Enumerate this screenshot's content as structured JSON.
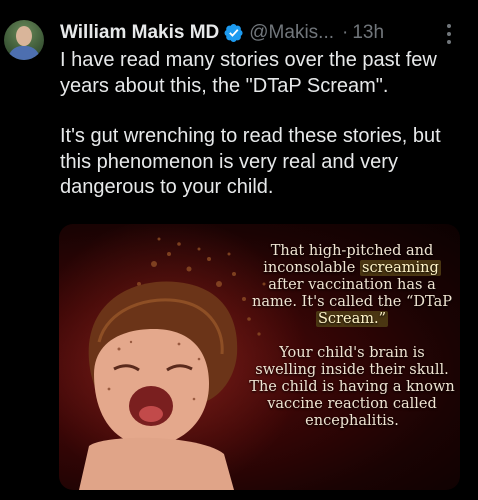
{
  "author": {
    "name": "William Makis MD",
    "handle": "@Makis...",
    "separator": "·",
    "time": "13h",
    "verified_color": "#1d9bf0"
  },
  "icons": {
    "verified": "verified-badge-icon",
    "more": "more-options-icon",
    "avatar": "profile-avatar"
  },
  "tweet": {
    "paragraph1": "I have read many stories over the past few years about this, the \"DTaP Scream\".",
    "paragraph2": "It's gut wrenching to read these stories, but this phenomenon is very real and very dangerous to your child."
  },
  "image": {
    "caption1_before": "That high-pitched and inconsolable ",
    "caption1_highlight": "screaming",
    "caption1_after": " after vaccination has  a name. It's called the “DTaP ",
    "caption1_highlight2": "Scream.”",
    "caption2": "Your child's brain is swelling inside their skull. The child is having a known vaccine reaction called encephalitis."
  }
}
